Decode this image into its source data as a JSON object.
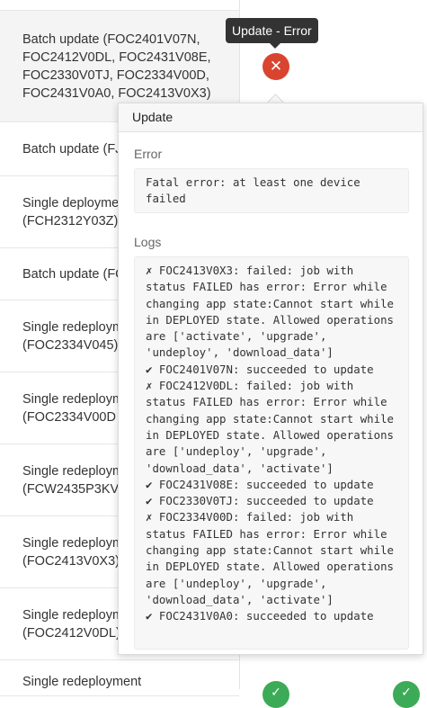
{
  "job_rows": [
    {
      "text": "Batch update (FOC2401V07N,\nFOC2412V0DL, FOC2431V08E,\nFOC2330V0TJ, FOC2334V00D,\nFOC2431V0A0, FOC2413V0X3)",
      "selected": true
    },
    {
      "text": "Batch update (FJ"
    },
    {
      "text": "Single deploymen\n(FCH2312Y03Z)"
    },
    {
      "text": "Batch update (FC"
    },
    {
      "text": "Single redeploym\n(FOC2334V045)"
    },
    {
      "text": "Single redeploym\n(FOC2334V00D"
    },
    {
      "text": "Single redeploym\n(FCW2435P3KV"
    },
    {
      "text": "Single redeploym\n(FOC2413V0X3)"
    },
    {
      "text": "Single redeploym\n(FOC2412V0DL)"
    },
    {
      "text": "Single redeployment"
    }
  ],
  "tooltip": {
    "text": "Update - Error"
  },
  "status": {
    "error_icon": "✕",
    "success_icon": "✓"
  },
  "popover": {
    "title": "Update",
    "error_label": "Error",
    "error_text": "Fatal error: at least one device\nfailed",
    "logs_label": "Logs",
    "logs_text": "✗ FOC2413V0X3: failed: job with\nstatus FAILED has error: Error while\nchanging app state:Cannot start while\nin DEPLOYED state. Allowed operations\nare ['activate', 'upgrade',\n'undeploy', 'download_data']\n✔ FOC2401V07N: succeeded to update\n✗ FOC2412V0DL: failed: job with\nstatus FAILED has error: Error while\nchanging app state:Cannot start while\nin DEPLOYED state. Allowed operations\nare ['undeploy', 'upgrade',\n'download_data', 'activate']\n✔ FOC2431V08E: succeeded to update\n✔ FOC2330V0TJ: succeeded to update\n✗ FOC2334V00D: failed: job with\nstatus FAILED has error: Error while\nchanging app state:Cannot start while\nin DEPLOYED state. Allowed operations\nare ['undeploy', 'upgrade',\n'download_data', 'activate']\n✔ FOC2431V0A0: succeeded to update"
  },
  "colors": {
    "error": "#d9442f",
    "success": "#3cab57",
    "tooltip_bg": "#333333"
  }
}
